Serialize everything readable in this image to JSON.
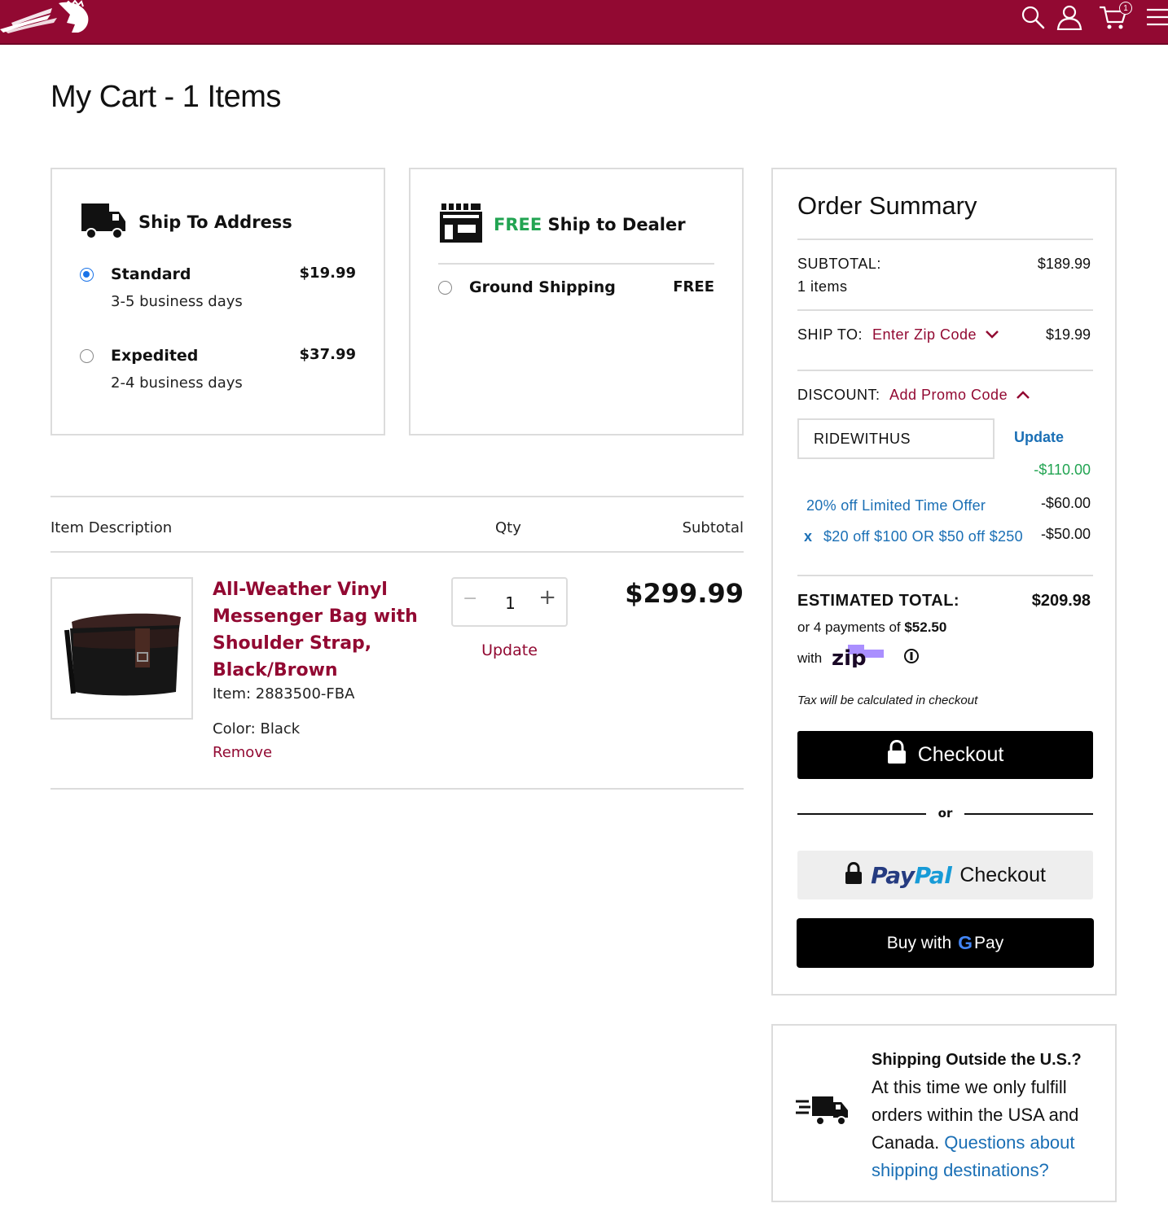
{
  "header": {
    "logo": "Indian logo",
    "icons": [
      "search-icon",
      "account-icon",
      "cart-icon",
      "menu-icon"
    ],
    "cart_count": "1",
    "brand_color": "#920932"
  },
  "page": {
    "title": "My Cart - 1 Items"
  },
  "shipping": {
    "address": {
      "title": "Ship To Address",
      "options": [
        {
          "label": "Standard",
          "price": "$19.99",
          "days": "3-5 business days",
          "selected": true
        },
        {
          "label": "Expedited",
          "price": "$37.99",
          "days": "2-4 business days",
          "selected": false
        }
      ]
    },
    "dealer": {
      "free_word": "FREE",
      "title_rest": " Ship to Dealer",
      "option": {
        "label": "Ground Shipping",
        "price": "FREE",
        "selected": false
      }
    }
  },
  "table": {
    "col_description": "Item Description",
    "col_qty": "Qty",
    "col_subtotal": "Subtotal"
  },
  "item": {
    "name": "All-Weather Vinyl Messenger Bag with Shoulder Strap, Black/Brown",
    "sku": "Item: 2883500-FBA",
    "color": "Color: Black",
    "remove": "Remove",
    "qty": "1",
    "qty_minus": "−",
    "qty_plus": "+",
    "update": "Update",
    "price": "$299.99"
  },
  "summary": {
    "title": "Order Summary",
    "subtotal_label": "SUBTOTAL:",
    "subtotal_value": "$189.99",
    "items_count": "1 items",
    "ship_to_label": "SHIP TO:",
    "ship_to_link": "Enter Zip Code",
    "ship_value": "$19.99",
    "discount_label": "DISCOUNT:",
    "discount_link": "Add Promo Code",
    "promo_code": "RIDEWITHUS",
    "promo_update": "Update",
    "discount_total": "-$110.00",
    "discounts": [
      {
        "remove": "",
        "label": "20% off Limited Time Offer",
        "amount": "-$60.00"
      },
      {
        "remove": "x",
        "label": "$20 off $100 OR $50 off $250",
        "amount": "-$50.00"
      }
    ],
    "estimated_label": "ESTIMATED TOTAL:",
    "estimated_value": "$209.98",
    "zip_prefix": "or 4 payments of ",
    "zip_amount": "$52.50",
    "zip_with": "with",
    "zip_brand": "zip",
    "tax_note": "Tax will be calculated in checkout",
    "checkout": "Checkout",
    "or": "or",
    "paypal_pay": "Pay",
    "paypal_pal": "Pal",
    "paypal_checkout": "Checkout",
    "gpay_prefix": "Buy with",
    "gpay_g": "G",
    "gpay_pay": "Pay"
  },
  "notice": {
    "title": "Shipping Outside the U.S.?",
    "body": "At this time we only fulfill orders within the USA and Canada. ",
    "link": "Questions about shipping destinations?"
  }
}
